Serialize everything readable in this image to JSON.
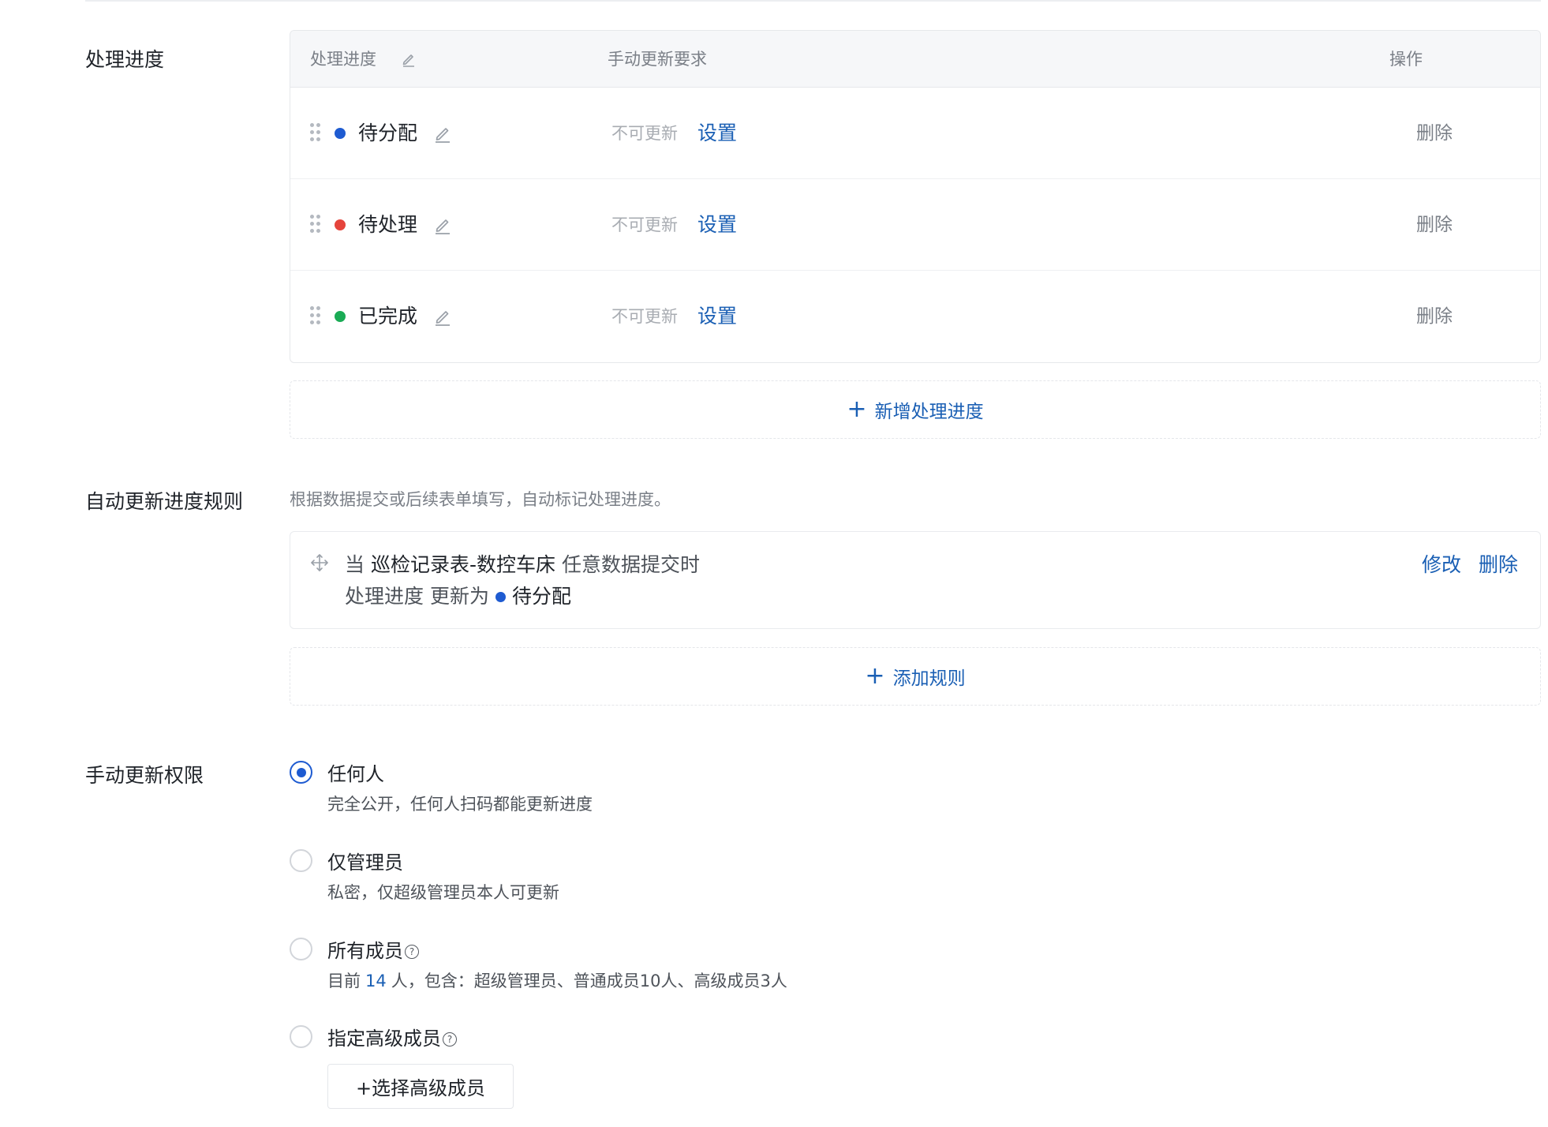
{
  "sections": {
    "progress": "处理进度",
    "auto_rules": "自动更新进度规则",
    "manual_permission": "手动更新权限"
  },
  "table": {
    "headers": {
      "progress": "处理进度",
      "manual_requirement": "手动更新要求",
      "actions": "操作"
    },
    "rows": [
      {
        "name": "待分配",
        "dot_color": "#1e5bd1",
        "requirement": "不可更新",
        "set_label": "设置",
        "delete_label": "删除"
      },
      {
        "name": "待处理",
        "dot_color": "#e5443c",
        "requirement": "不可更新",
        "set_label": "设置",
        "delete_label": "删除"
      },
      {
        "name": "已完成",
        "dot_color": "#1aab55",
        "requirement": "不可更新",
        "set_label": "设置",
        "delete_label": "删除"
      }
    ],
    "add_label": "新增处理进度"
  },
  "auto_rules": {
    "hint": "根据数据提交或后续表单填写，自动标记处理进度。",
    "rule": {
      "when": "当",
      "form_name": "巡检记录表-数控车床",
      "trigger": "任意数据提交时",
      "field": "处理进度",
      "update_to": "更新为",
      "target_status": "待分配",
      "target_color": "#1e5bd1",
      "edit_label": "修改",
      "delete_label": "删除"
    },
    "add_label": "添加规则"
  },
  "permissions": {
    "selected": 0,
    "options": [
      {
        "title": "任何人",
        "desc": "完全公开，任何人扫码都能更新进度"
      },
      {
        "title": "仅管理员",
        "desc": "私密，仅超级管理员本人可更新"
      },
      {
        "title": "所有成员",
        "desc_prefix": "目前",
        "count": "14",
        "desc_suffix": "人，包含：超级管理员、普通成员10人、高级成员3人"
      },
      {
        "title": "指定高级成员"
      }
    ],
    "help_glyph": "?",
    "choose_button": "+选择高级成员"
  },
  "colors": {
    "accent": "#1a5fb4",
    "radio": "#1e5bd1"
  }
}
